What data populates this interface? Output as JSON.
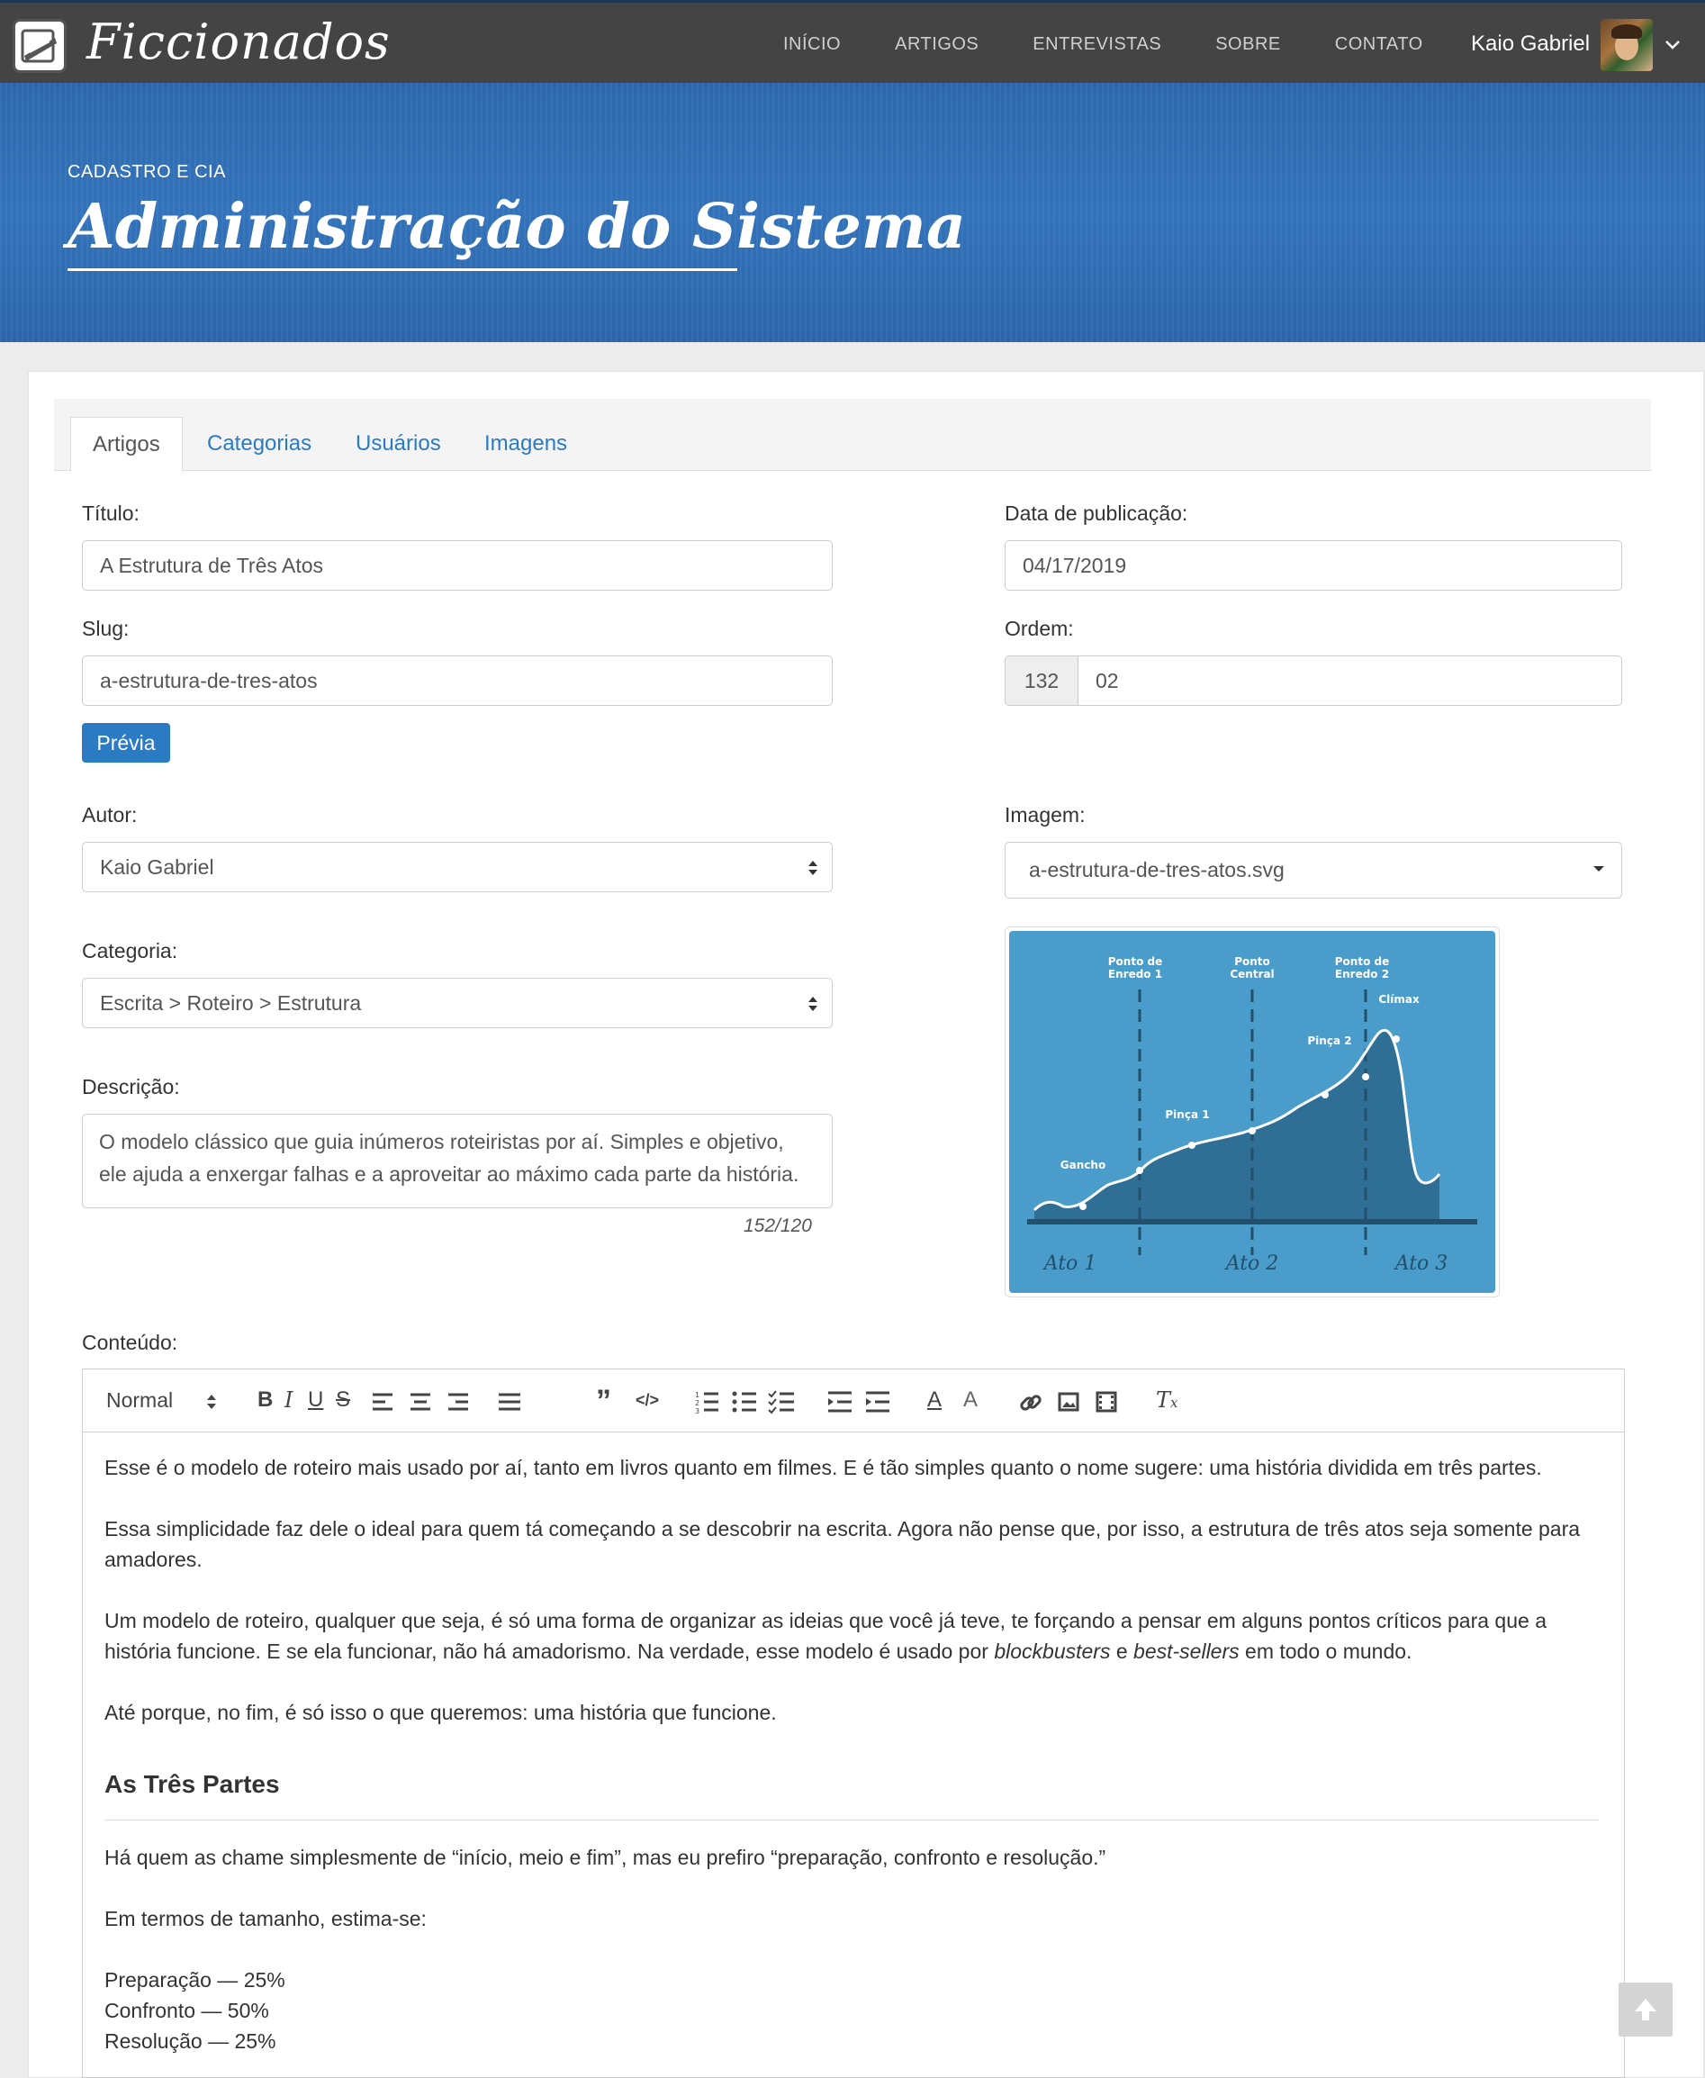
{
  "brand": {
    "name": "Ficcionados"
  },
  "nav": {
    "items": [
      "INÍCIO",
      "ARTIGOS",
      "ENTREVISTAS",
      "SOBRE",
      "CONTATO"
    ]
  },
  "user": {
    "name": "Kaio Gabriel"
  },
  "hero": {
    "subtitle": "CADASTRO E CIA",
    "title": "Administração do Sistema"
  },
  "tabs": [
    "Artigos",
    "Categorias",
    "Usuários",
    "Imagens"
  ],
  "form": {
    "titulo": {
      "label": "Título:",
      "value": "A Estrutura de Três Atos"
    },
    "data": {
      "label": "Data de publicação:",
      "value": "04/17/2019"
    },
    "slug": {
      "label": "Slug:",
      "value": "a-estrutura-de-tres-atos"
    },
    "ordem": {
      "label": "Ordem:",
      "prefix": "132",
      "value": "02"
    },
    "previa": "Prévia",
    "autor": {
      "label": "Autor:",
      "value": "Kaio Gabriel"
    },
    "imagem": {
      "label": "Imagem:",
      "value": "a-estrutura-de-tres-atos.svg"
    },
    "categoria": {
      "label": "Categoria:",
      "value": "Escrita > Roteiro > Estrutura"
    },
    "descricao": {
      "label": "Descrição:",
      "value": "O modelo clássico que guia inúmeros roteiristas por aí. Simples e objetivo, ele ajuda a enxergar falhas e a aproveitar ao máximo cada parte da história.",
      "counter": "152/120"
    },
    "conteudo": {
      "label": "Conteúdo:"
    }
  },
  "image_preview": {
    "labels": {
      "pe1a": "Ponto de",
      "pe1b": "Enredo 1",
      "pcA": "Ponto",
      "pcB": "Central",
      "pe2a": "Ponto de",
      "pe2b": "Enredo 2",
      "climax": "Clímax",
      "pinca2": "Pinça 2",
      "pinca1": "Pinça 1",
      "gancho": "Gancho",
      "ato1": "Ato 1",
      "ato2": "Ato 2",
      "ato3": "Ato 3"
    },
    "colors": {
      "bg": "#4a9ccb",
      "fill": "#2f6f96",
      "line": "#ffffff"
    }
  },
  "editor": {
    "format": "Normal",
    "p1": "Esse é o modelo de roteiro mais usado por aí, tanto em livros quanto em filmes. E é tão simples quanto o nome sugere: uma história dividida em três partes.",
    "p2": "Essa simplicidade faz dele o ideal para quem tá começando a se descobrir na escrita. Agora não pense que, por isso, a estrutura de três atos seja somente para amadores.",
    "p3a": "Um modelo de roteiro, qualquer que seja, é só uma forma de organizar as ideias que você já teve, te forçando a pensar em alguns pontos críticos para que a história funcione. E se ela funcionar, não há amadorismo. Na verdade, esse modelo é usado por ",
    "p3b": "blockbusters",
    "p3c": " e ",
    "p3d": "best-sellers",
    "p3e": " em todo o mundo.",
    "p4": "Até porque, no fim, é só isso o que queremos: uma história que funcione.",
    "h": "As Três Partes",
    "p5": "Há quem as chame simplesmente de “início, meio e fim”, mas eu prefiro “preparação, confronto e resolução.”",
    "p6": "Em termos de tamanho, estima-se:",
    "l1": "Preparação — 25%",
    "l2": "Confronto — 50%",
    "l3": "Resolução — 25%"
  }
}
